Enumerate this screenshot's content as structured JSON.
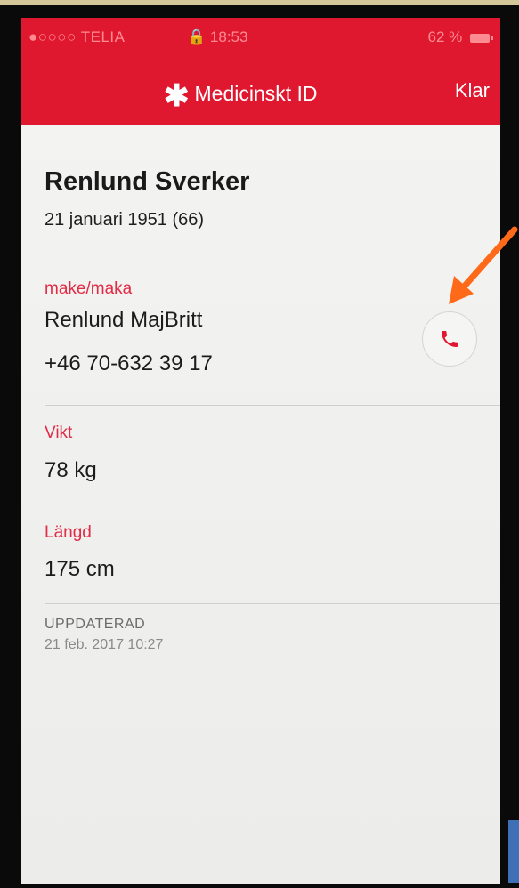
{
  "status_bar": {
    "carrier": "●○○○○ TELIA",
    "time": "18:53",
    "battery": "62 %"
  },
  "nav": {
    "title": "Medicinskt ID",
    "done_label": "Klar",
    "title_icon": "asterisk-icon"
  },
  "profile": {
    "name": "Renlund Sverker",
    "birth": "21 januari 1951 (66)"
  },
  "emergency_contact": {
    "relation_label": "make/maka",
    "name": "Renlund MajBritt",
    "phone": "+46 70-632 39 17",
    "call_icon": "phone-icon"
  },
  "weight": {
    "label": "Vikt",
    "value": "78 kg"
  },
  "height": {
    "label": "Längd",
    "value": "175 cm"
  },
  "updated": {
    "label": "UPPDATERAD",
    "value": "21 feb. 2017 10:27"
  },
  "colors": {
    "brand_red": "#e0182f",
    "label_red": "#e22b46",
    "annotation_arrow": "#ff6a1a"
  }
}
